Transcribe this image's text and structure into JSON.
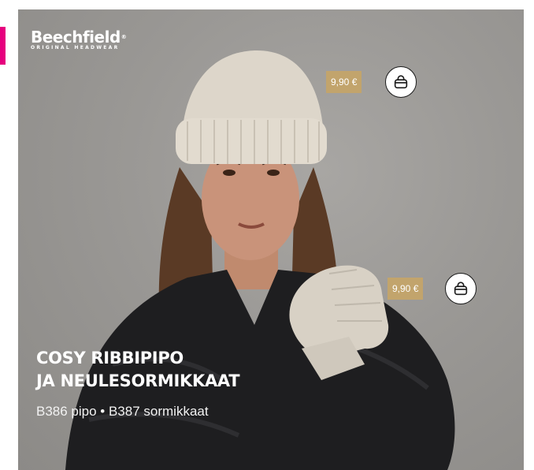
{
  "brand": {
    "name": "Beechfield",
    "registered": "®",
    "tagline": "ORIGINAL HEADWEAR"
  },
  "products": [
    {
      "price": "9,90 €"
    },
    {
      "price": "9,90 €"
    }
  ],
  "headline": {
    "line1": "COSY RIBBIPIPO",
    "line2": "JA NEULESORMIKKAAT"
  },
  "subtitle": "B386 pipo • B387 sormikkaat",
  "icons": {
    "cart": "shopping-bag-icon"
  },
  "colors": {
    "accent": "#e6007e",
    "price_tag": "#c2a46c"
  }
}
